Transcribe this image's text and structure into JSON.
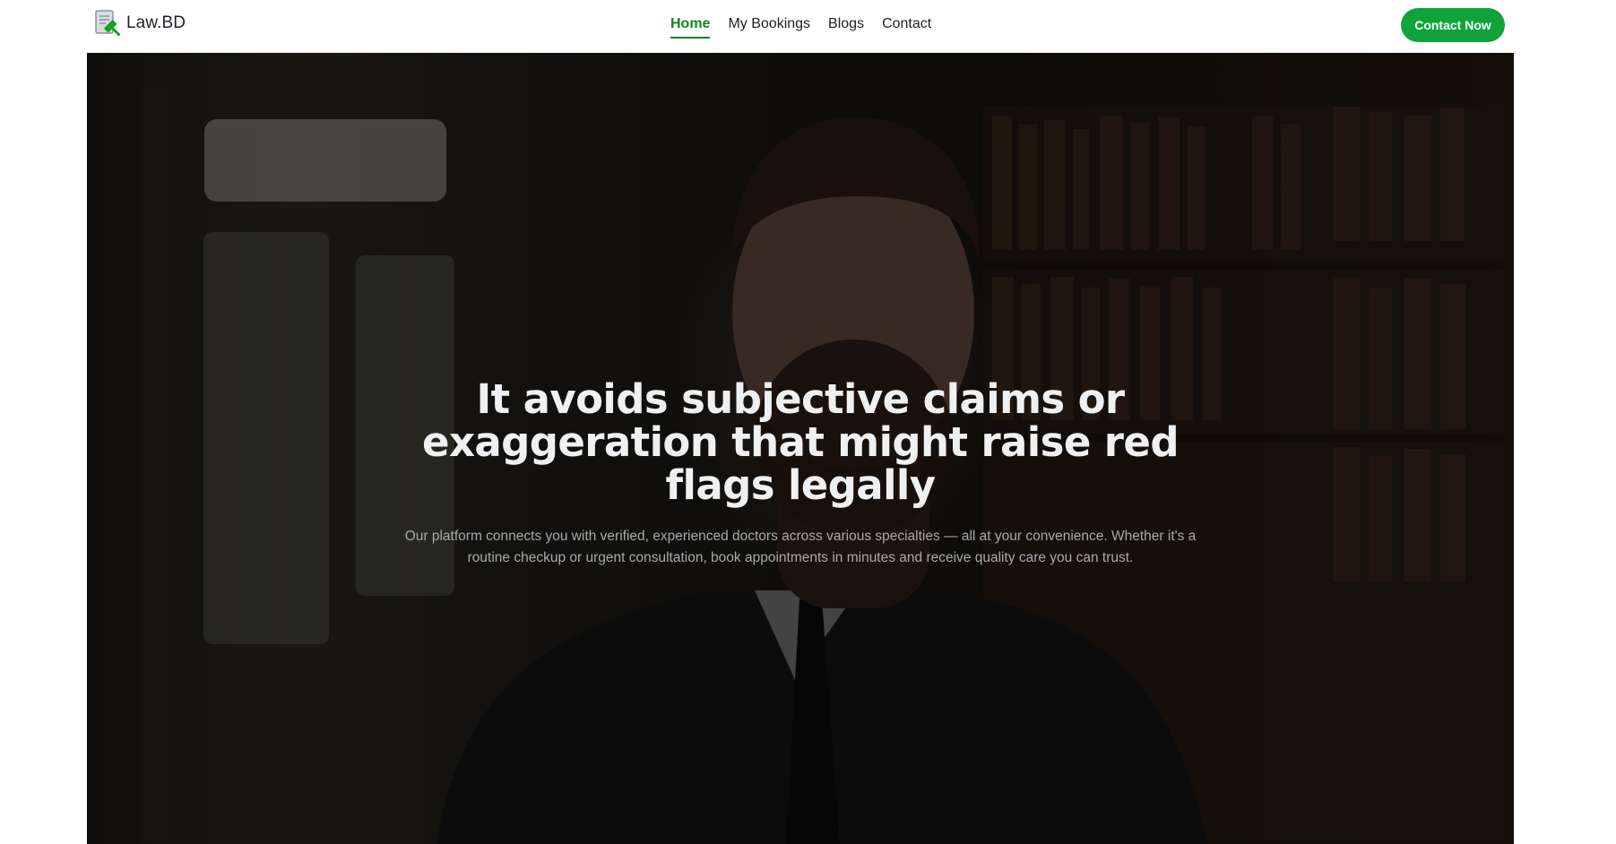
{
  "brand": {
    "name": "Law.BD",
    "icon": "law-document-gavel-icon",
    "accent_color": "#13861f",
    "button_color": "#0fa33a"
  },
  "nav": {
    "items": [
      {
        "label": "Home",
        "active": true
      },
      {
        "label": "My Bookings",
        "active": false
      },
      {
        "label": "Blogs",
        "active": false
      },
      {
        "label": "Contact",
        "active": false
      }
    ],
    "cta_label": "Contact Now"
  },
  "hero": {
    "title": "It avoids subjective claims or exaggeration that might raise red flags legally",
    "subtitle": "Our platform connects you with verified, experienced doctors across various specialties — all at your convenience. Whether it's a routine checkup or urgent consultation, book appointments in minutes and receive quality care you can trust."
  }
}
